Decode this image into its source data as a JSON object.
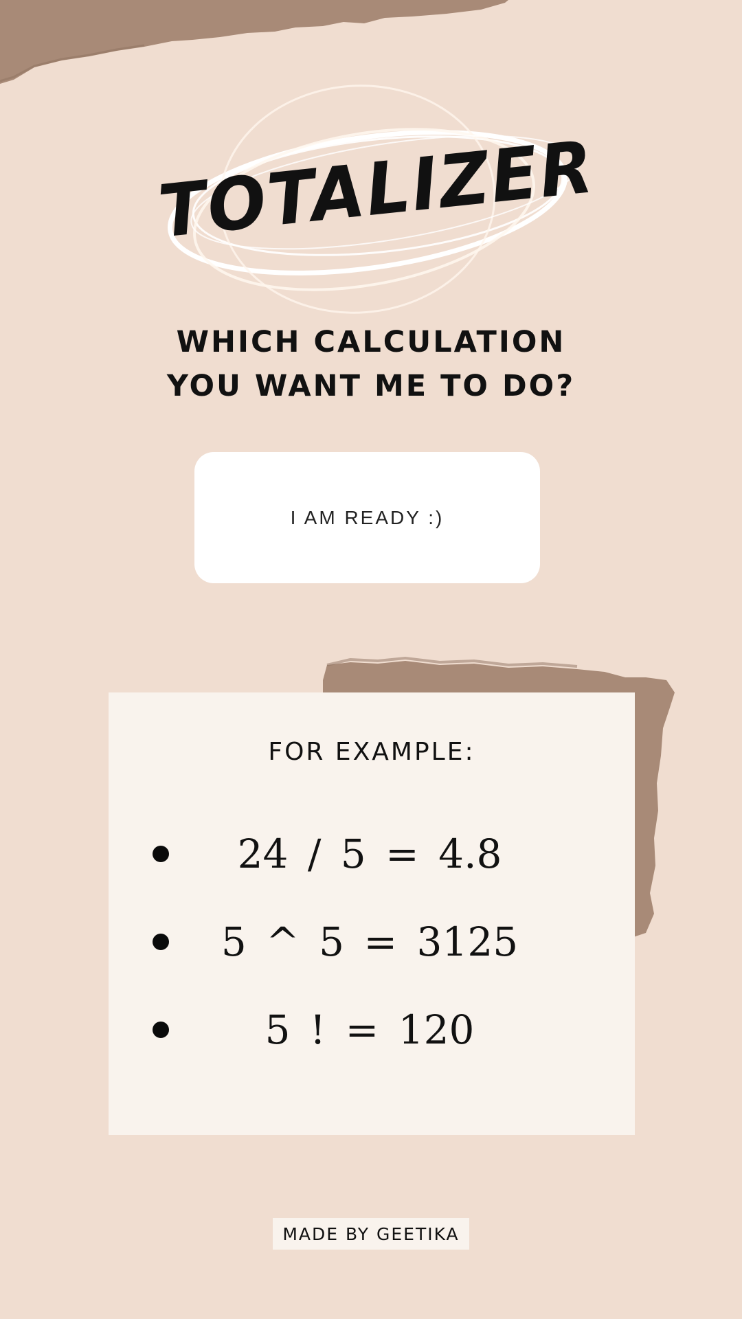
{
  "header": {
    "title": "TOTALIZER"
  },
  "question": {
    "line1": "WHICH CALCULATION",
    "line2": "YOU WANT ME TO DO?"
  },
  "ready_button": {
    "label": "I AM READY :)"
  },
  "examples": {
    "title": "FOR EXAMPLE:",
    "items": [
      "24 / 5 = 4.8",
      "5 ^ 5 = 3125",
      "5 ! = 120"
    ]
  },
  "footer": {
    "credit": "MADE BY GEETIKA"
  },
  "colors": {
    "background": "#f0ddd0",
    "torn_paper": "#a88a77",
    "card": "#f9f3ed",
    "button": "#ffffff",
    "text": "#111111"
  }
}
